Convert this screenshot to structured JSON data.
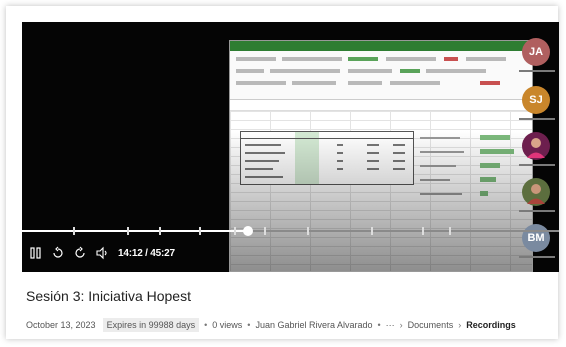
{
  "player": {
    "current_time": "14:12",
    "duration": "45:27",
    "time_display": "14:12 / 45:27",
    "progress": 0.42,
    "chapters": [
      0.095,
      0.195,
      0.255,
      0.33,
      0.395,
      0.45,
      0.53,
      0.65,
      0.745,
      0.795
    ]
  },
  "participants": [
    {
      "initials": "JA",
      "color": "#b05f5f"
    },
    {
      "initials": "SJ",
      "color": "#c9862b"
    },
    {
      "initials": "",
      "color": "#8a2a6a",
      "photo": true
    },
    {
      "initials": "",
      "color": "#4a6a3a",
      "photo": true
    },
    {
      "initials": "BM",
      "color": "#7a8aa0"
    }
  ],
  "video": {
    "title": "Sesión 3: Iniciativa Hopest",
    "date": "October 13, 2023",
    "expires": "Expires in 99988 days",
    "views": "0 views",
    "owner": "Juan Gabriel Rivera Alvarado",
    "more": "···",
    "breadcrumb_1": "Documents",
    "breadcrumb_2": "Recordings"
  },
  "icons": {
    "pause": "pause-icon",
    "rewind": "rewind-10-icon",
    "forward": "forward-10-icon",
    "volume": "volume-icon"
  }
}
